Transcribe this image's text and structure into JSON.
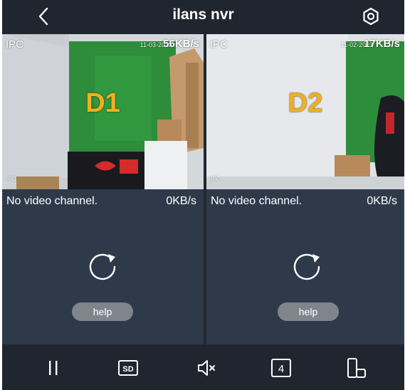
{
  "header": {
    "title": "ilans nvr",
    "back_icon": "chevron-left-icon",
    "settings_icon": "settings-gear-icon"
  },
  "channels": [
    {
      "ipc_label": "IPC",
      "timestamp": "11-03-2023",
      "rate": "56KB/s",
      "big_label": "D1",
      "corner_label": "IPC",
      "selected": true
    },
    {
      "ipc_label": "IPC",
      "timestamp": "11-02-2023",
      "rate": "17KB/s",
      "big_label": "D2",
      "corner_label": "IPC",
      "selected": false
    },
    {
      "message": "No video channel.",
      "rate": "0KB/s",
      "help_label": "help"
    },
    {
      "message": "No video channel.",
      "rate": "0KB/s",
      "help_label": "help"
    }
  ],
  "toolbar": {
    "sd_label": "SD",
    "split_count": "4",
    "icons": [
      "pause-icon",
      "sd-quality-icon",
      "mute-icon",
      "split-4-icon",
      "rotate-device-icon"
    ]
  },
  "colors": {
    "background": "#2b3645",
    "bar": "#1f2630",
    "accent": "#4a90e2",
    "label": "#f2b01e",
    "help_button": "#7f858c"
  }
}
